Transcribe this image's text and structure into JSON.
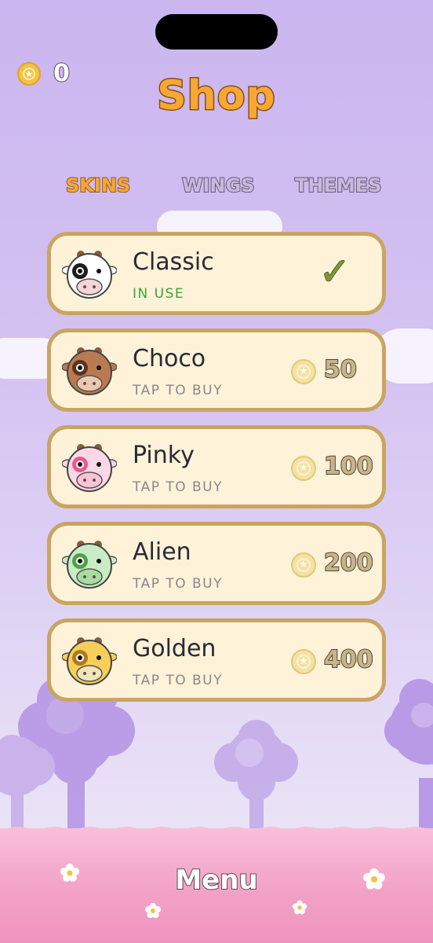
{
  "coins": {
    "count": "0"
  },
  "title": "Shop",
  "tabs": [
    {
      "label": "SKINS",
      "active": true
    },
    {
      "label": "WINGS",
      "active": false
    },
    {
      "label": "THEMES",
      "active": false
    }
  ],
  "skins": [
    {
      "name": "Classic",
      "status": "IN USE",
      "owned": true,
      "colors": {
        "face": "#ffffff",
        "spot": "#1e1e1e",
        "snout": "#f5d5d8"
      }
    },
    {
      "name": "Choco",
      "status": "TAP TO BUY",
      "price": "50",
      "colors": {
        "face": "#b97a52",
        "spot": "#5a3320",
        "snout": "#eec6b0"
      }
    },
    {
      "name": "Pinky",
      "status": "TAP TO BUY",
      "price": "100",
      "colors": {
        "face": "#fcd8e6",
        "spot": "#e85b8c",
        "snout": "#f9c4d6"
      }
    },
    {
      "name": "Alien",
      "status": "TAP TO BUY",
      "price": "200",
      "colors": {
        "face": "#c9ecc4",
        "spot": "#4ea24a",
        "snout": "#a8dca0"
      }
    },
    {
      "name": "Golden",
      "status": "TAP TO BUY",
      "price": "400",
      "colors": {
        "face": "#f6cf5a",
        "spot": "#b07a1e",
        "snout": "#f2e5b7"
      }
    }
  ],
  "menu_label": "Menu",
  "icons": {
    "coin": "coin-star-icon",
    "check": "checkmark-icon"
  }
}
